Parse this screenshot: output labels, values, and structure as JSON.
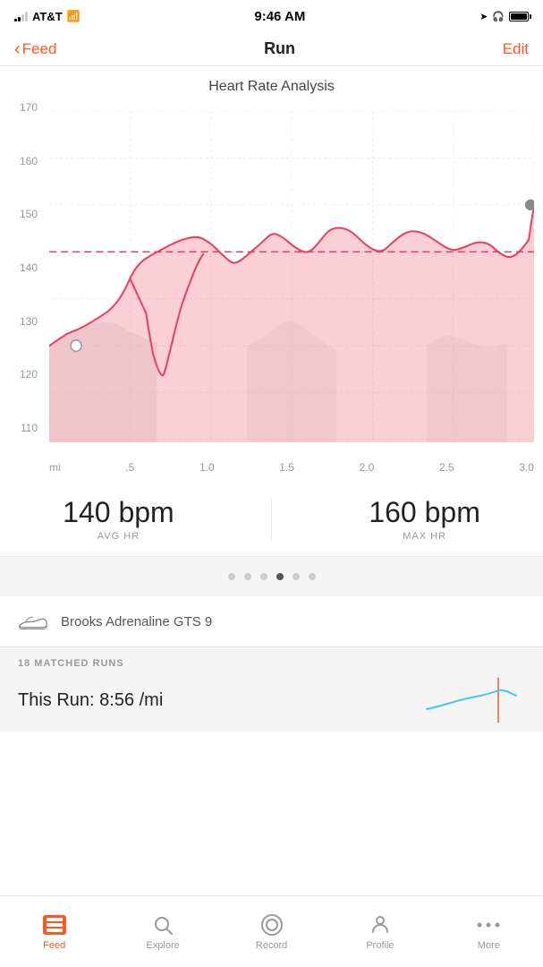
{
  "statusBar": {
    "carrier": "AT&T",
    "time": "9:46 AM"
  },
  "header": {
    "backLabel": "Feed",
    "title": "Run",
    "editLabel": "Edit"
  },
  "chart": {
    "title": "Heart Rate Analysis",
    "yLabels": [
      "170",
      "160",
      "150",
      "140",
      "130",
      "120",
      "110"
    ],
    "xLabels": [
      "mi",
      ".5",
      "1.0",
      "1.5",
      "2.0",
      "2.5",
      "3.0"
    ],
    "avgLine": 140
  },
  "stats": {
    "avg": {
      "value": "140 bpm",
      "label": "AVG HR"
    },
    "max": {
      "value": "160 bpm",
      "label": "MAX HR"
    }
  },
  "pageDots": {
    "count": 6,
    "active": 3
  },
  "shoe": {
    "name": "Brooks Adrenaline GTS 9"
  },
  "matchedRuns": {
    "label": "18 MATCHED RUNS",
    "thisRun": "This Run: 8:56 /mi"
  },
  "tabBar": {
    "items": [
      {
        "id": "feed",
        "label": "Feed",
        "active": true
      },
      {
        "id": "explore",
        "label": "Explore",
        "active": false
      },
      {
        "id": "record",
        "label": "Record",
        "active": false
      },
      {
        "id": "profile",
        "label": "Profile",
        "active": false
      },
      {
        "id": "more",
        "label": "More",
        "active": false
      }
    ]
  }
}
